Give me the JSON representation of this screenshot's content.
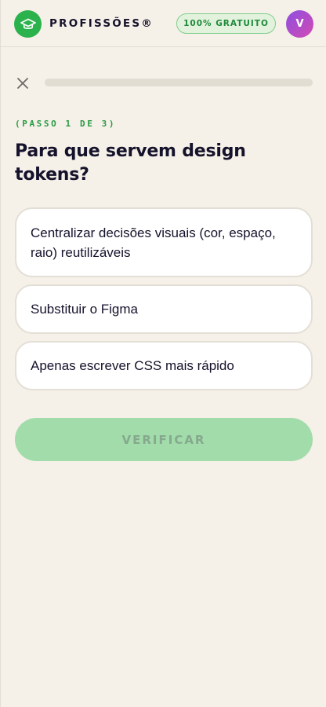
{
  "header": {
    "logo_icon": "graduation-cap-icon",
    "brand": "PROFISSÕES®",
    "badge": "100% GRATUITO",
    "avatar_initial": "V"
  },
  "quiz": {
    "close_icon": "close-icon",
    "progress": 0,
    "step_label": "(PASSO 1 DE 3)",
    "question": "Para que servem design tokens?",
    "options": [
      {
        "label": "Centralizar decisões visuais (cor, espaço, raio) reutilizáveis"
      },
      {
        "label": "Substituir o Figma"
      },
      {
        "label": "Apenas escrever CSS mais rápido"
      }
    ],
    "verify_label": "VERIFICAR"
  },
  "colors": {
    "background": "#f5f0e8",
    "brand_green": "#2bb24c",
    "badge_bg": "#e3f2dc",
    "verify_disabled_bg": "#a1dcaa",
    "text_dark": "#15122b"
  }
}
